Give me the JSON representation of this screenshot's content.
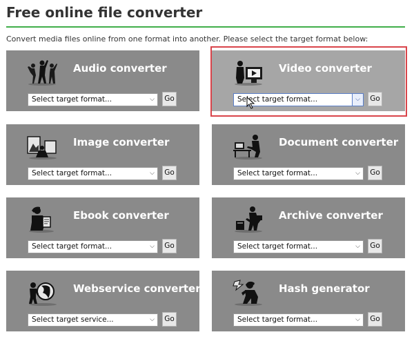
{
  "page": {
    "title": "Free online file converter",
    "subtitle": "Convert media files online from one format into another. Please select the target format below:"
  },
  "colors": {
    "accent_rule": "#3fae49",
    "tile_background": "#8a8a8a",
    "tile_highlight_background": "#a6a6a6",
    "highlight_border": "#d9444a"
  },
  "converters": [
    {
      "title": "Audio converter",
      "select_value": "Select target format...",
      "go_label": "Go",
      "icon": "dancers-icon"
    },
    {
      "title": "Video converter",
      "select_value": "Select target format...",
      "go_label": "Go",
      "icon": "video-viewer-icon",
      "highlighted": true
    },
    {
      "title": "Image converter",
      "select_value": "Select target format...",
      "go_label": "Go",
      "icon": "photo-frames-icon"
    },
    {
      "title": "Document converter",
      "select_value": "Select target format...",
      "go_label": "Go",
      "icon": "desk-worker-icon"
    },
    {
      "title": "Ebook converter",
      "select_value": "Select target format...",
      "go_label": "Go",
      "icon": "ebook-reader-icon"
    },
    {
      "title": "Archive converter",
      "select_value": "Select target format...",
      "go_label": "Go",
      "icon": "box-carrier-icon"
    },
    {
      "title": "Webservice converter",
      "select_value": "Select target service...",
      "go_label": "Go",
      "icon": "globe-person-icon"
    },
    {
      "title": "Hash generator",
      "select_value": "Select target format...",
      "go_label": "Go",
      "icon": "hash-thinker-icon"
    }
  ]
}
